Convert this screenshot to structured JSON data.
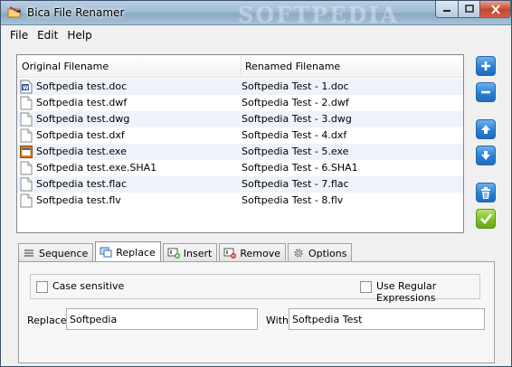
{
  "window": {
    "title": "Bica File Renamer",
    "watermark": "SOFTPEDIA"
  },
  "menu": [
    "File",
    "Edit",
    "Help"
  ],
  "table": {
    "headers": [
      "Original Filename",
      "Renamed Filename"
    ],
    "rows": [
      {
        "original": "Softpedia test.doc",
        "renamed": "Softpedia Test - 1.doc",
        "icon": "word-doc-icon"
      },
      {
        "original": "Softpedia test.dwf",
        "renamed": "Softpedia Test - 2.dwf",
        "icon": "blank-file-icon"
      },
      {
        "original": "Softpedia test.dwg",
        "renamed": "Softpedia Test - 3.dwg",
        "icon": "blank-file-icon"
      },
      {
        "original": "Softpedia test.dxf",
        "renamed": "Softpedia Test - 4.dxf",
        "icon": "blank-file-icon"
      },
      {
        "original": "Softpedia test.exe",
        "renamed": "Softpedia Test - 5.exe",
        "icon": "exe-file-icon"
      },
      {
        "original": "Softpedia test.exe.SHA1",
        "renamed": "Softpedia Test - 6.SHA1",
        "icon": "blank-file-icon"
      },
      {
        "original": "Softpedia test.flac",
        "renamed": "Softpedia Test - 7.flac",
        "icon": "blank-file-icon"
      },
      {
        "original": "Softpedia test.flv",
        "renamed": "Softpedia Test - 8.flv",
        "icon": "blank-file-icon"
      }
    ]
  },
  "side_buttons": [
    "plus-icon",
    "minus-icon",
    "arrow-up-icon",
    "arrow-down-icon",
    "trash-icon",
    "checkmark-icon"
  ],
  "tabs": [
    {
      "label": "Sequence",
      "icon": "list-icon"
    },
    {
      "label": "Replace",
      "icon": "replace-icon",
      "active": true
    },
    {
      "label": "Insert",
      "icon": "insert-icon"
    },
    {
      "label": "Remove",
      "icon": "remove-icon"
    },
    {
      "label": "Options",
      "icon": "gear-icon"
    }
  ],
  "replace_panel": {
    "case_sensitive_label": "Case sensitive",
    "case_sensitive_checked": false,
    "regex_label": "Use Regular Expressions",
    "regex_checked": false,
    "replace_label": "Replace",
    "replace_value": "Softpedia",
    "with_label": "With",
    "with_value": "Softpedia Test"
  },
  "colors": {
    "accent_blue": "#2a7fd4",
    "accept_green": "#7fbf28",
    "row_alt": "#eef3fa",
    "close_red": "#c8452b"
  }
}
